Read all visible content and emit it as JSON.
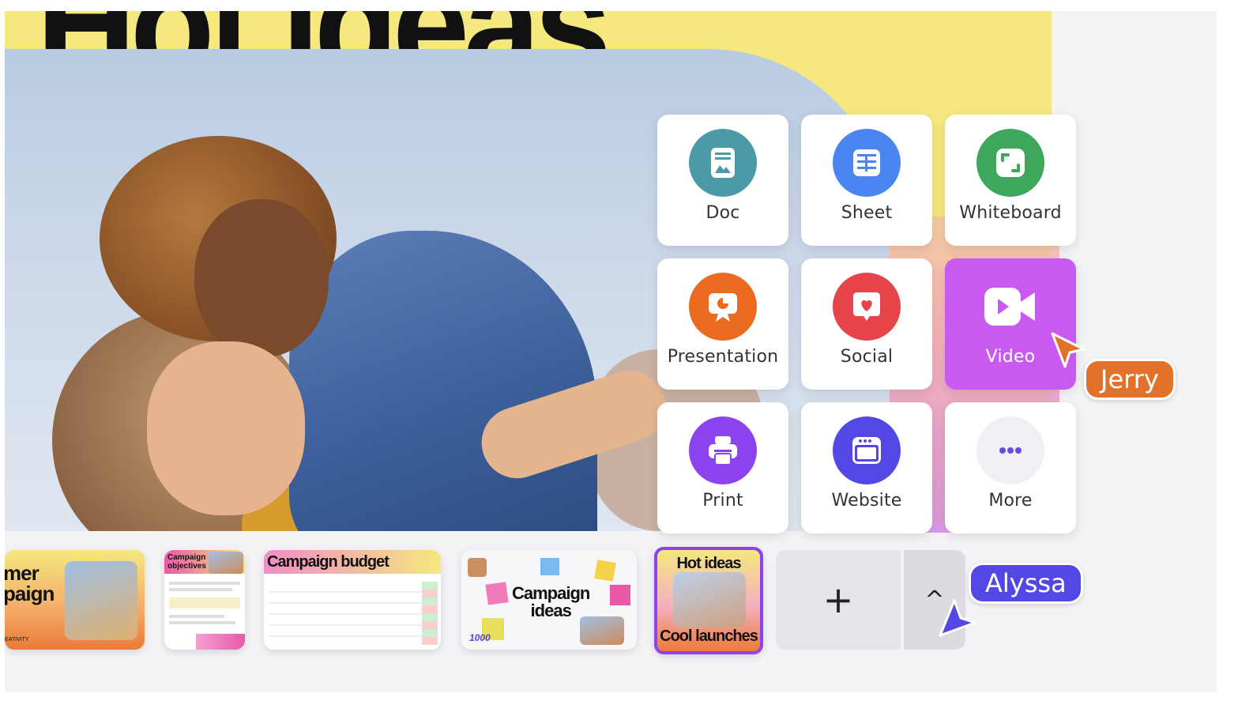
{
  "background_slide": {
    "headline": "Hot ideas"
  },
  "create_menu": {
    "items": [
      {
        "label": "Doc",
        "icon": "doc-icon",
        "color": "#4a9aa8"
      },
      {
        "label": "Sheet",
        "icon": "sheet-icon",
        "color": "#4a86f2"
      },
      {
        "label": "Whiteboard",
        "icon": "whiteboard-icon",
        "color": "#3da75c"
      },
      {
        "label": "Presentation",
        "icon": "presentation-icon",
        "color": "#ea6b1f"
      },
      {
        "label": "Social",
        "icon": "social-icon",
        "color": "#e6434b"
      },
      {
        "label": "Video",
        "icon": "video-icon",
        "color": "#c95af1",
        "selected": true
      },
      {
        "label": "Print",
        "icon": "print-icon",
        "color": "#8b43f0"
      },
      {
        "label": "Website",
        "icon": "website-icon",
        "color": "#5348e6"
      },
      {
        "label": "More",
        "icon": "more-icon",
        "color": "#f0eff3"
      }
    ]
  },
  "thumbnails": [
    {
      "title_line1": "mer",
      "title_line2": "paign",
      "footer": "EATIVITY"
    },
    {
      "title": "Campaign objectives"
    },
    {
      "title": "Campaign budget"
    },
    {
      "title_line1": "Campaign",
      "title_line2": "ideas",
      "badge": "1000"
    },
    {
      "title_top": "Hot ideas",
      "title_bottom": "Cool launches",
      "selected": true
    }
  ],
  "controls": {
    "add_label": "+",
    "collapse_label": "^"
  },
  "collaborators": [
    {
      "name": "Jerry",
      "color": "#e2712a"
    },
    {
      "name": "Alyssa",
      "color": "#5348e6"
    }
  ]
}
